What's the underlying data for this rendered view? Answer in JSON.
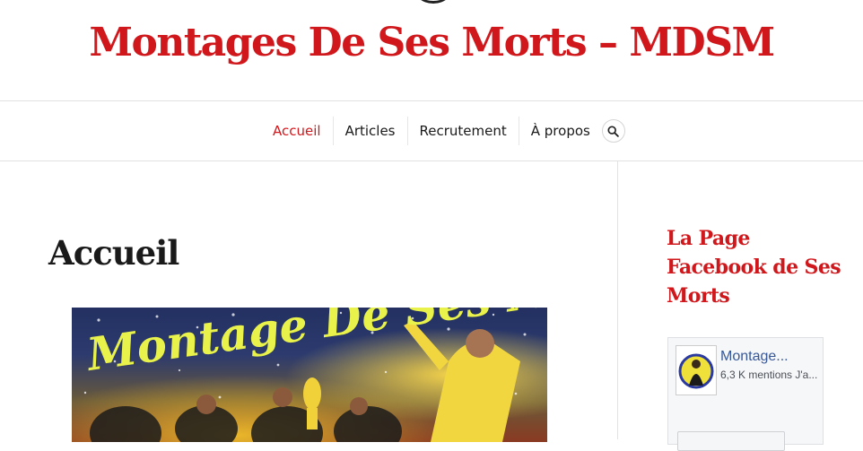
{
  "site": {
    "title": "Montages De Ses Morts – MDSM"
  },
  "nav": {
    "items": [
      {
        "label": "Accueil",
        "active": true
      },
      {
        "label": "Articles",
        "active": false
      },
      {
        "label": "Recrutement",
        "active": false
      },
      {
        "label": "À propos",
        "active": false
      }
    ],
    "search_icon": "search-icon"
  },
  "main": {
    "page_title": "Accueil",
    "hero_banner_text": "Montage De Ses Morts"
  },
  "sidebar": {
    "widget_title": "La Page Facebook de Ses Morts",
    "facebook": {
      "page_name": "Montage...",
      "likes": "6,3 K mentions J'a..."
    }
  },
  "colors": {
    "accent": "#d0181c",
    "text": "#1a1a1a",
    "facebook_link": "#365899",
    "banner_text": "#e8f24a"
  }
}
